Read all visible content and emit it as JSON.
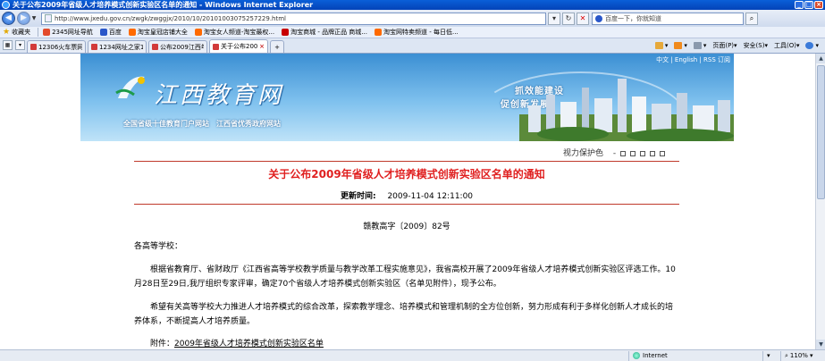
{
  "window": {
    "title": "关于公布2009年省级人才培养模式创新实验区名单的通知 - Windows Internet Explorer"
  },
  "address": {
    "url": "http://www.jxedu.gov.cn/zwgk/zwggjx/2010/10/20101003075257229.html",
    "search_placeholder": "百度一下，你就知道"
  },
  "favorites": {
    "label": "收藏夹",
    "items": [
      {
        "label": "2345网址导航",
        "color": "#e34b2c"
      },
      {
        "label": "百度",
        "color": "#2a57c9"
      },
      {
        "label": "淘宝皇冠店铺大全",
        "color": "#ff6a00"
      },
      {
        "label": "淘宝女人频道-淘宝最权...",
        "color": "#ff6a00"
      },
      {
        "label": "淘宝商城 - 品牌正品 商城...",
        "color": "#c80000"
      },
      {
        "label": "淘宝网特卖频道 - 每日低...",
        "color": "#ff6a00"
      }
    ]
  },
  "tabs": [
    {
      "label": "12306火车票网上订票官网..."
    },
    {
      "label": "1234网址之家1234网址导航"
    },
    {
      "label": "公布2009江西年人才培养..."
    },
    {
      "label": "关于公布2009年省级人...",
      "active": true
    }
  ],
  "commands": {
    "page": "页面(P)",
    "safety": "安全(S)",
    "tools": "工具(O)"
  },
  "site": {
    "lang_links": "中文 | English | RSS 订阅",
    "logo_text": "江西教育网",
    "slogan": "全国省级十佳教育门户网站　江西省优秀政府网站",
    "tagline1": "抓效能建设",
    "tagline2": "促创新发展",
    "care_label": "视力保护色"
  },
  "article": {
    "title": "关于公布2009年省级人才培养模式创新实验区名单的通知",
    "update_label": "更新时间:",
    "update_time": "2009-11-04 12:11:00",
    "doc_number": "赣教高字〔2009〕82号",
    "salutation": "各高等学校：",
    "para1": "根据省教育厅、省财政厅《江西省高等学校教学质量与教学改革工程实施意见》，我省高校开展了2009年省级人才培养模式创新实验区评选工作。10月28日至29日,我厅组织专家评审，确定70个省级人才培养模式创新实验区（名单见附件），现予公布。",
    "para2": "希望有关高等学校大力推进人才培养模式的综合改革，探索教学理念、培养模式和管理机制的全方位创新，努力形成有利于多样化创新人才成长的培养体系，不断提高人才培养质量。",
    "attach_label": "附件：",
    "attach_link": "2009年省级人才培养模式创新实验区名单"
  },
  "status": {
    "zone": "Internet",
    "zoom": "110%"
  }
}
